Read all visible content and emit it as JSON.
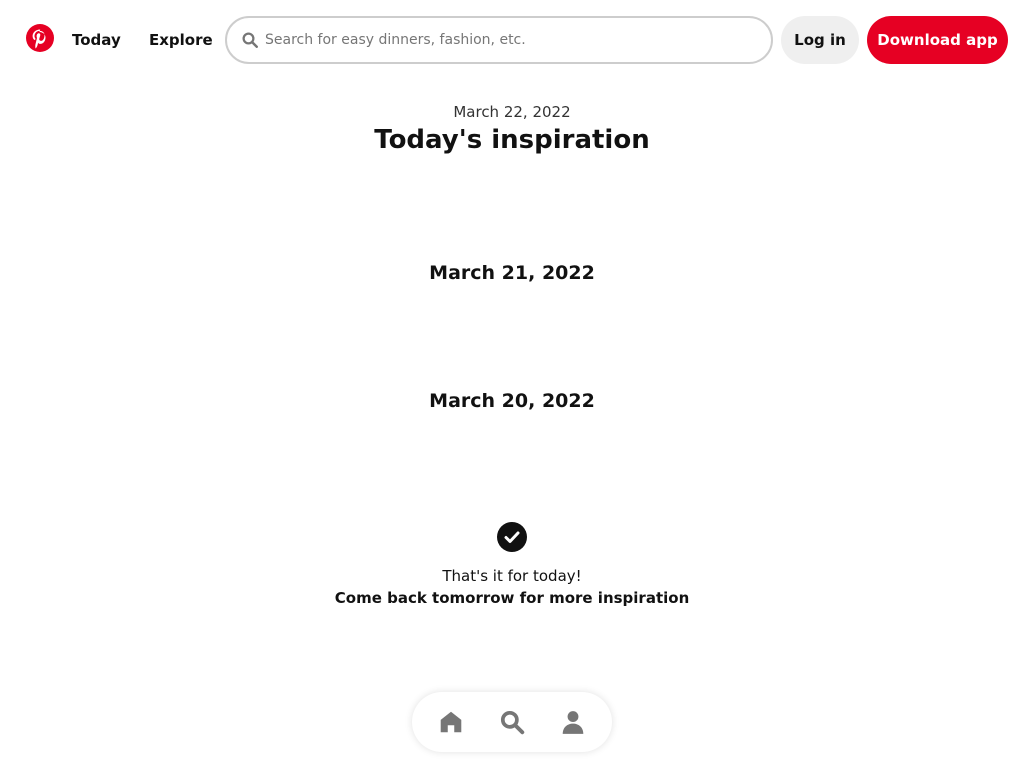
{
  "header": {
    "logo_icon": "pinterest-logo-icon",
    "nav": [
      {
        "label": "Today"
      },
      {
        "label": "Explore"
      }
    ],
    "search": {
      "icon": "search-icon",
      "placeholder": "Search for easy dinners, fashion, etc.",
      "value": ""
    },
    "login_label": "Log in",
    "download_label": "Download app"
  },
  "main": {
    "date": "March 22, 2022",
    "title": "Today's inspiration",
    "sections": [
      {
        "date": "March 21, 2022"
      },
      {
        "date": "March 20, 2022"
      }
    ],
    "end": {
      "icon": "checkmark-circle-icon",
      "line1": "That's it for today!",
      "line2": "Come back tomorrow for more inspiration"
    }
  },
  "bottom_nav": {
    "items": [
      {
        "icon": "home-icon"
      },
      {
        "icon": "search-icon"
      },
      {
        "icon": "profile-icon"
      }
    ]
  },
  "colors": {
    "brand": "#e60023",
    "text": "#111111",
    "secondary_button": "#efefef",
    "icon_gray": "#767676"
  }
}
